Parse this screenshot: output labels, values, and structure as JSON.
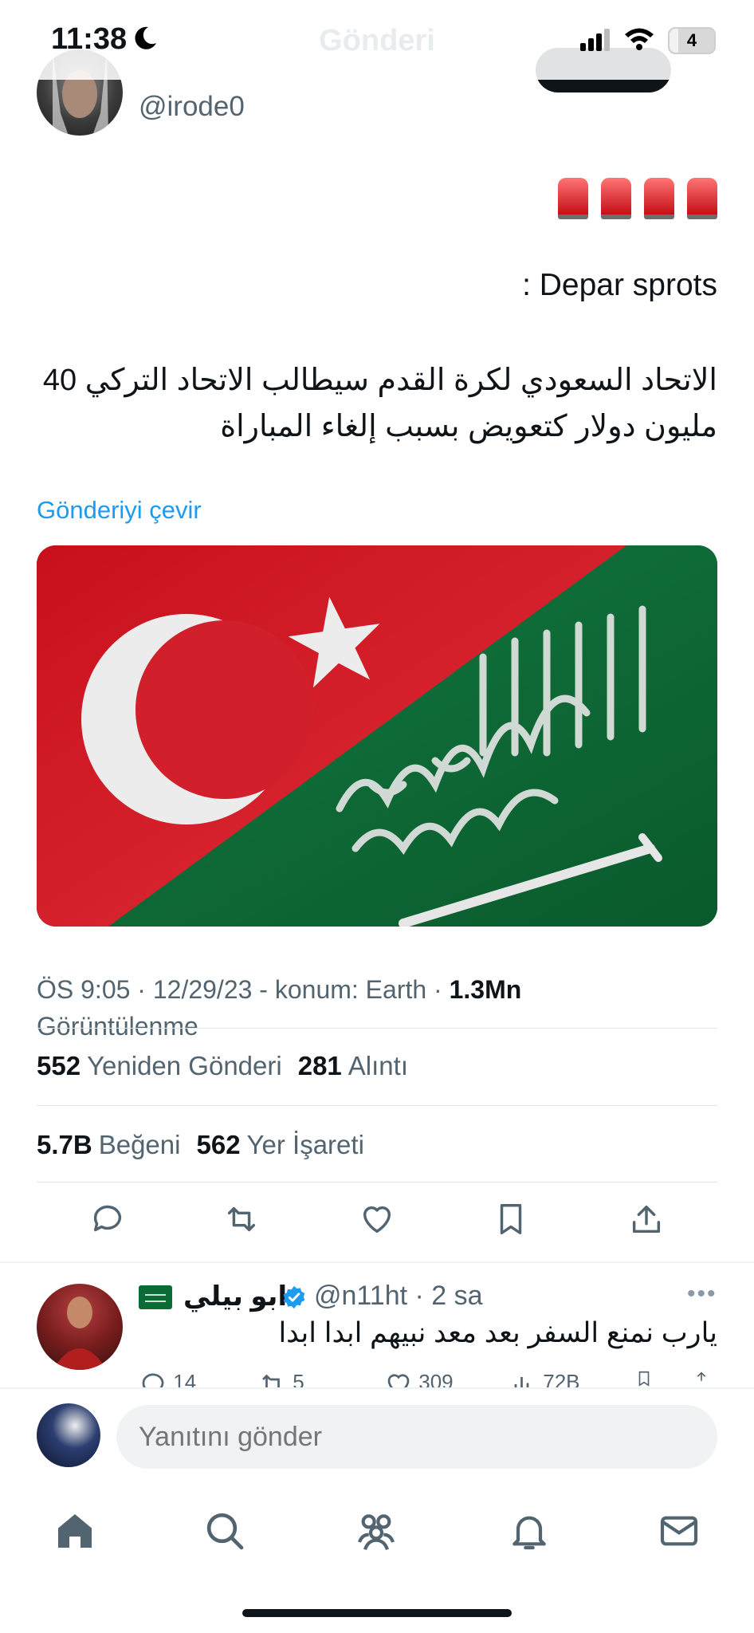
{
  "status_bar": {
    "time": "11:38",
    "nav_title": "Gönderi",
    "battery": "4",
    "battery_fraction": 0.2
  },
  "tweet": {
    "author_handle": "@irode0",
    "emoji_line": "🚨🚨🚨🚨",
    "source_line": ": Depar sprots",
    "body_arabic": "الاتحاد السعودي لكرة القدم سيطالب الاتحاد التركي 40 مليون دولار كتعويض بسبب إلغاء المباراة",
    "translate_label": "Gönderiyi çevir",
    "meta": {
      "time": "ÖS 9:05",
      "date": "12/29/23",
      "location": "konum: Earth",
      "views_count": "1.3Mn",
      "views_label": "Görüntülenme"
    },
    "stats": {
      "reposts_count": "552",
      "reposts_label": "Yeniden Gönderi",
      "quotes_count": "281",
      "quotes_label": "Alıntı",
      "likes_count": "5.7B",
      "likes_label": "Beğeni",
      "bookmarks_count": "562",
      "bookmarks_label": "Yer İşareti"
    },
    "actions": [
      "reply-icon",
      "repost-icon",
      "like-icon",
      "bookmark-icon",
      "share-icon"
    ]
  },
  "reply": {
    "name": "ابو بيلي",
    "handle": "@n11ht",
    "time": "2 sa",
    "text": "يارب نمنع السفر بعد معد نبيهم ابدا ابدا",
    "counts": {
      "replies": "14",
      "reposts": "5",
      "likes": "309",
      "views": "72B"
    }
  },
  "compose": {
    "placeholder": "Yanıtını gönder"
  },
  "tab_bar": [
    "home-icon",
    "search-icon",
    "communities-icon",
    "notifications-icon",
    "messages-icon"
  ],
  "colors": {
    "accent": "#1d9bf0",
    "text_primary": "#0f1419",
    "text_secondary": "#536471",
    "turkey_red": "#d6202a",
    "saudi_green": "#0b6b34"
  }
}
